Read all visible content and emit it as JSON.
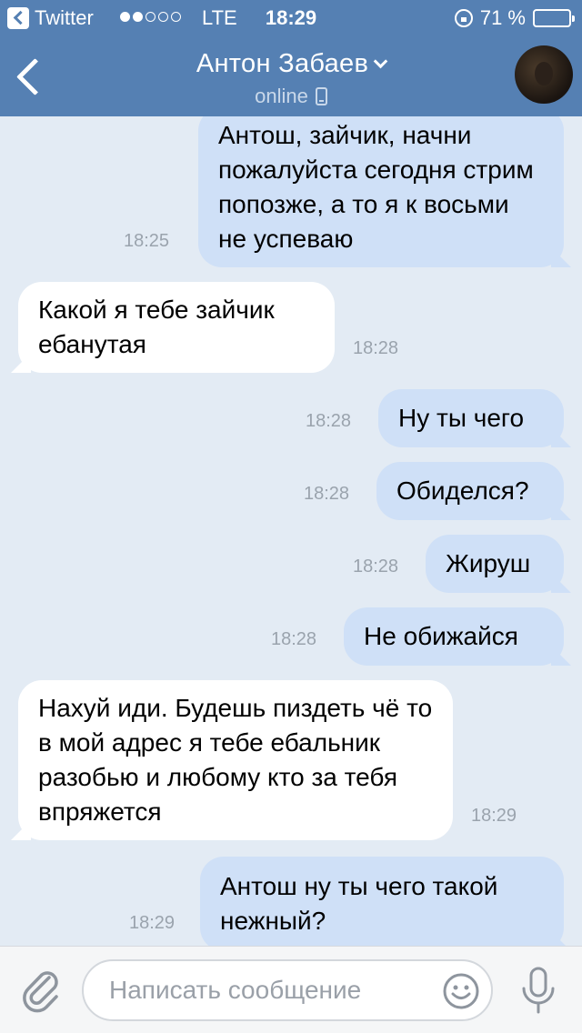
{
  "status_bar": {
    "back_app": "Twitter",
    "carrier": "LTE",
    "time": "18:29",
    "battery": "71 %",
    "battery_level": 0.71
  },
  "header": {
    "contact_name": "Антон Забаев",
    "status": "online",
    "icons": [
      "back-chevron-icon",
      "chevron-down-icon",
      "phone-icon",
      "avatar"
    ]
  },
  "messages": [
    {
      "dir": "out",
      "text": "Антош, зайчик, начни пожалуйста сегодня стрим попозже, а то я к восьми не успеваю",
      "time": "18:25"
    },
    {
      "dir": "in",
      "text": "Какой я тебе зайчик ебанутая",
      "time": "18:28"
    },
    {
      "dir": "out",
      "text": "Ну ты чего",
      "time": "18:28"
    },
    {
      "dir": "out",
      "text": "Обиделся?",
      "time": "18:28"
    },
    {
      "dir": "out",
      "text": "Жируш",
      "time": "18:28"
    },
    {
      "dir": "out",
      "text": "Не обижайся",
      "time": "18:28"
    },
    {
      "dir": "in",
      "text": "Нахуй иди. Будешь пиздеть чё то в мой адрес я тебе ебальник разобью и любому кто за тебя впряжется",
      "time": "18:29"
    },
    {
      "dir": "out",
      "text": "Антош ну ты чего такой нежный?",
      "time": "18:29"
    }
  ],
  "input": {
    "placeholder": "Написать сообщение",
    "icons": [
      "paperclip-icon",
      "emoji-icon",
      "microphone-icon"
    ]
  },
  "colors": {
    "header": "#5580b3",
    "chat_bg": "#e3ebf4",
    "outgoing_bubble": "#cfe0f7",
    "incoming_bubble": "#ffffff",
    "battery": "#f5c518"
  }
}
